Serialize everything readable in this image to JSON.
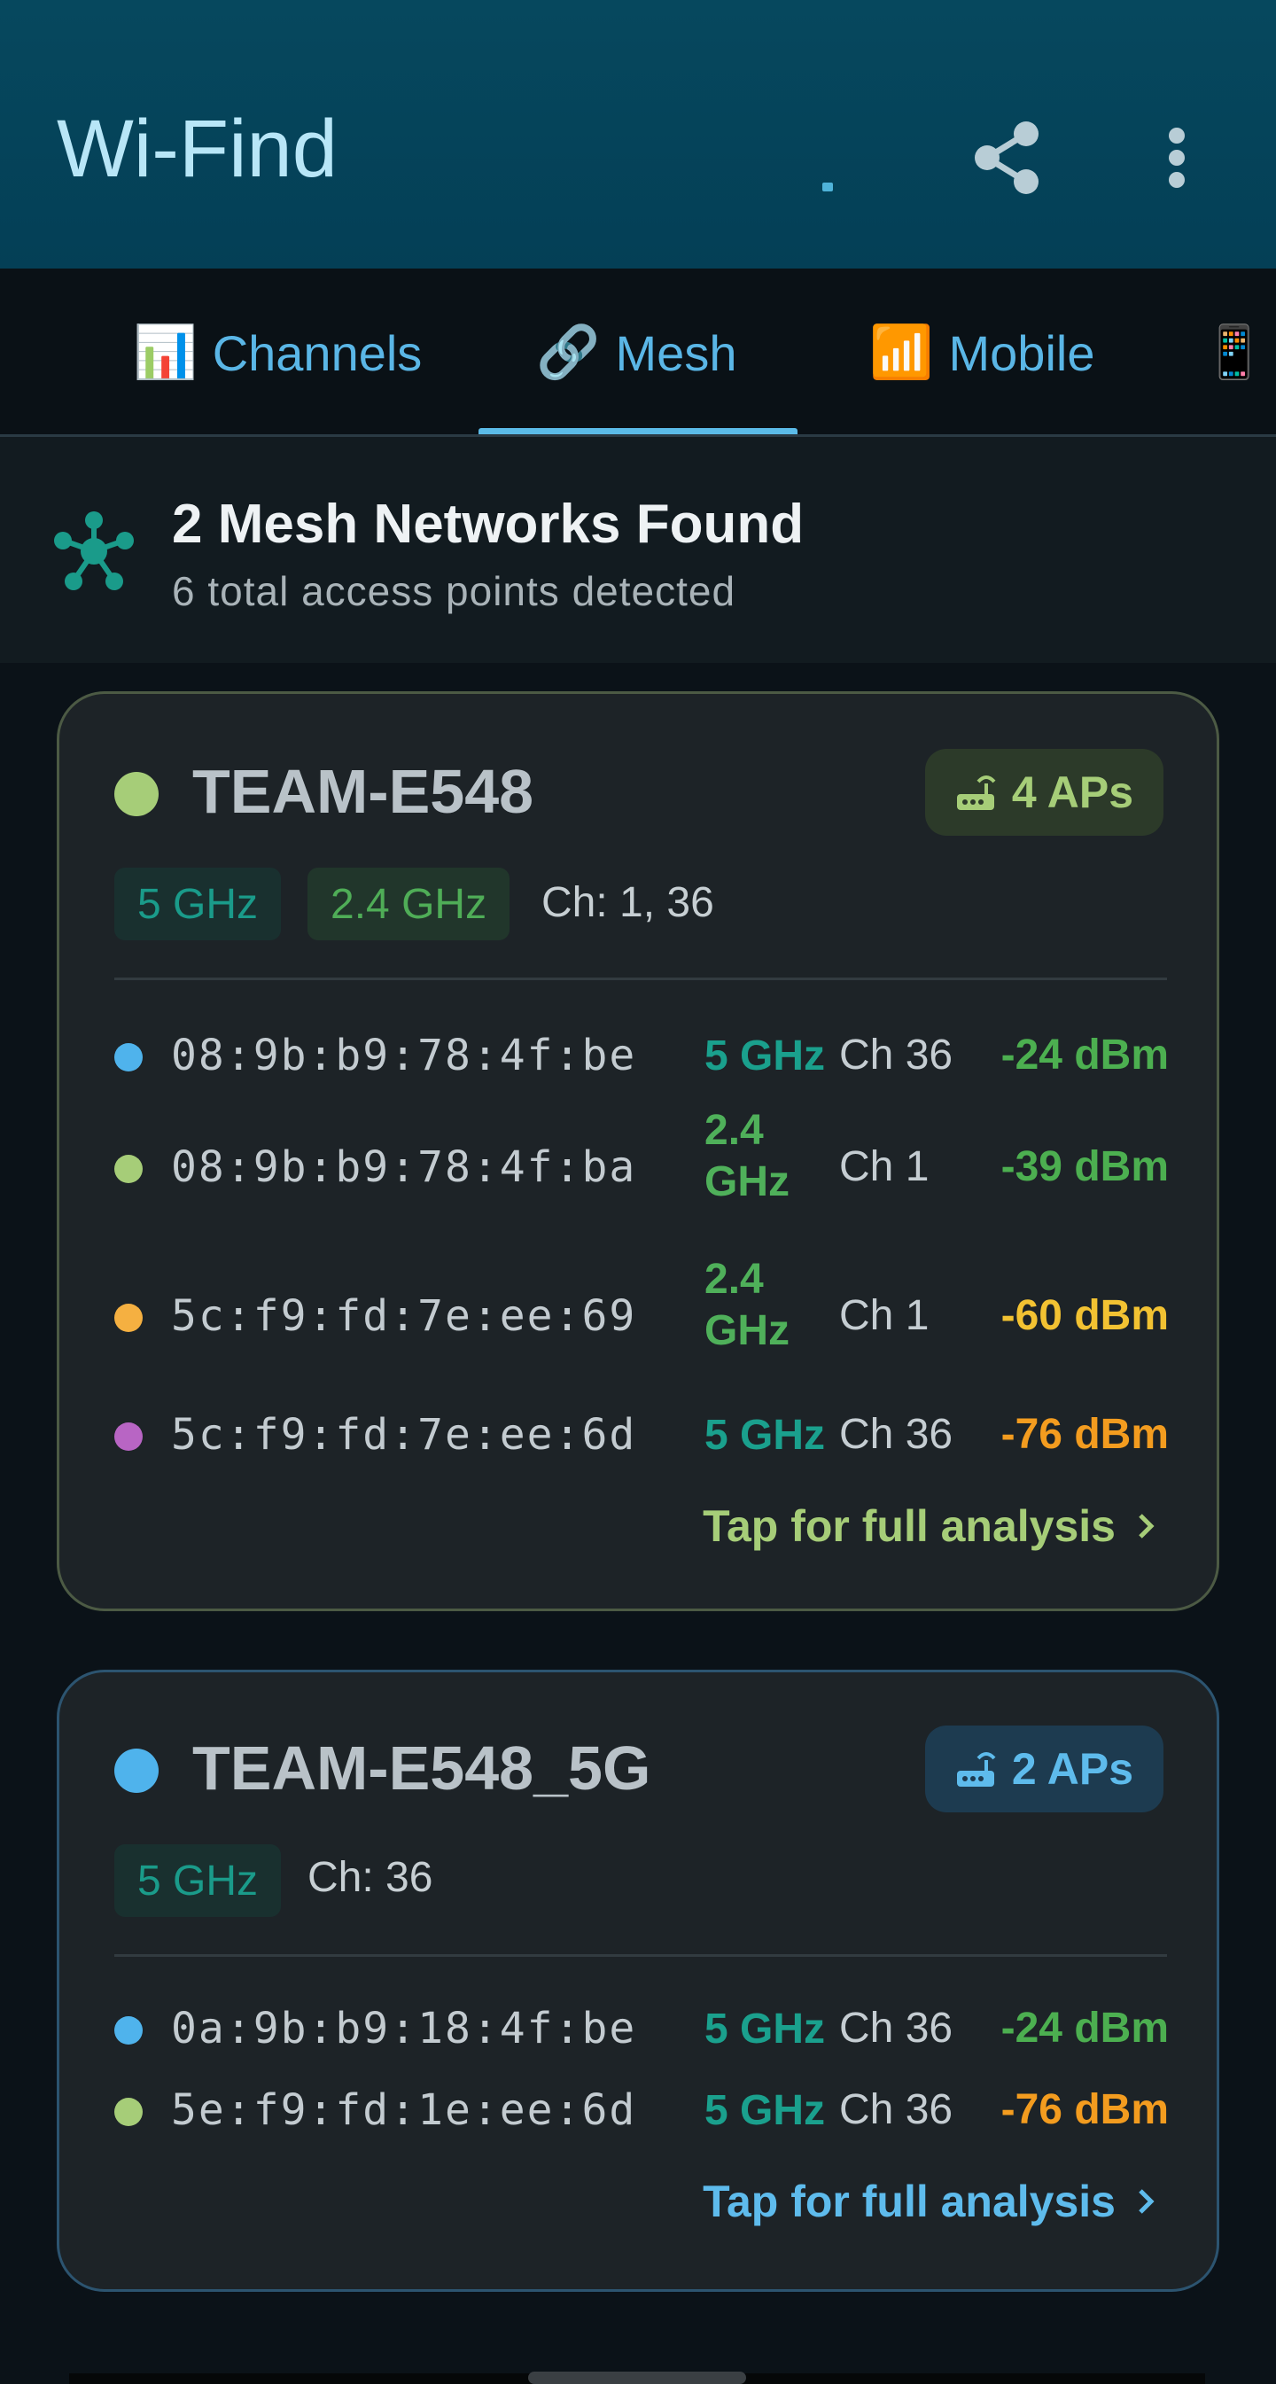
{
  "app": {
    "title": "Wi-Find",
    "colors": {
      "appbar": "#06485e",
      "accent": "#5bbbe8"
    },
    "actions": [
      {
        "icon": "share-icon"
      },
      {
        "icon": "more-vert-icon"
      }
    ]
  },
  "tabs": [
    {
      "emoji": "📊",
      "label": "Channels"
    },
    {
      "emoji": "🔗",
      "label": "Mesh",
      "selected": true
    },
    {
      "emoji": "📶",
      "label": "Mobile"
    },
    {
      "emoji": "📱",
      "label": ""
    }
  ],
  "summary": {
    "title": "2 Mesh Networks Found",
    "subtitle": "6 total access points detected",
    "icon": "mesh-network-icon"
  },
  "networks": [
    {
      "name": "TEAM-E548",
      "dot_color": "#a6cd78",
      "ap_count": "4 APs",
      "bands": [
        "5 GHz",
        "2.4 GHz"
      ],
      "channels": "Ch: 1, 36",
      "aps": [
        {
          "dot": "#4fb3ec",
          "mac": "08:9b:b9:78:4f:be",
          "band": "5 GHz",
          "channel": "Ch 36",
          "signal": "-24 dBm",
          "signal_color": "#4caf50"
        },
        {
          "dot": "#a6cd78",
          "mac": "08:9b:b9:78:4f:ba",
          "band": "2.4 GHz",
          "channel": "Ch 1",
          "signal": "-39 dBm",
          "signal_color": "#4caf50"
        },
        {
          "dot": "#f5b041",
          "mac": "5c:f9:fd:7e:ee:69",
          "band": "2.4 GHz",
          "channel": "Ch 1",
          "signal": "-60 dBm",
          "signal_color": "#f2c232"
        },
        {
          "dot": "#b865c4",
          "mac": "5c:f9:fd:7e:ee:6d",
          "band": "5 GHz",
          "channel": "Ch 36",
          "signal": "-76 dBm",
          "signal_color": "#f39c1f"
        }
      ],
      "action": "Tap for full analysis"
    },
    {
      "name": "TEAM-E548_5G",
      "dot_color": "#4fb3ec",
      "ap_count": "2 APs",
      "bands": [
        "5 GHz"
      ],
      "channels": "Ch: 36",
      "aps": [
        {
          "dot": "#4fb3ec",
          "mac": "0a:9b:b9:18:4f:be",
          "band": "5 GHz",
          "channel": "Ch 36",
          "signal": "-24 dBm",
          "signal_color": "#4caf50"
        },
        {
          "dot": "#a6cd78",
          "mac": "5e:f9:fd:1e:ee:6d",
          "band": "5 GHz",
          "channel": "Ch 36",
          "signal": "-76 dBm",
          "signal_color": "#f39c1f"
        }
      ],
      "action": "Tap for full analysis"
    }
  ]
}
